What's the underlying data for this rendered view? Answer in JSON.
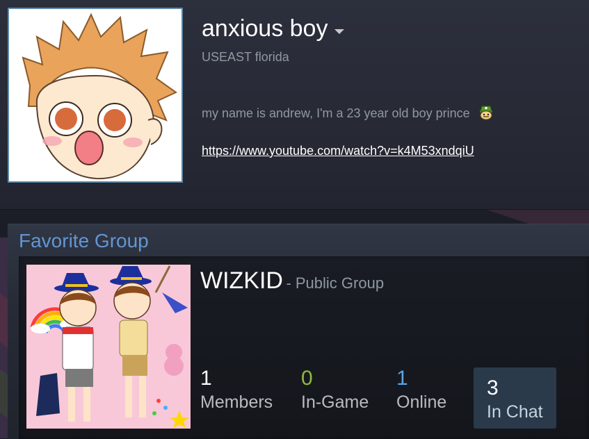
{
  "profile": {
    "persona_name": "anxious boy",
    "location": "USEAST florida",
    "summary_text": "my name is andrew, I'm a 23 year old boy prince",
    "summary_emoticon": "green-hat-face-emoticon",
    "link": "https://www.youtube.com/watch?v=k4M53xndqiU",
    "avatar_icon": "anime-boy-avatar",
    "avatar_border_color": "#5d8aa8"
  },
  "favorite_group": {
    "section_title": "Favorite Group",
    "name": "WIZKID",
    "type_label": "- Public Group",
    "avatar_icon": "wizard-kids-group-avatar",
    "stats": {
      "members": {
        "value": "1",
        "label": "Members"
      },
      "in_game": {
        "value": "0",
        "label": "In-Game"
      },
      "online": {
        "value": "1",
        "label": "Online"
      },
      "in_chat": {
        "value": "3",
        "label": "In Chat"
      }
    }
  },
  "colors": {
    "accent_blue": "#6396d4",
    "in_game_green": "#90ba3c",
    "online_blue": "#57a5e6",
    "chat_button_bg": "#2a3a4b",
    "header_bg": "#2c2f3c",
    "page_bg": "#1b1e27"
  }
}
